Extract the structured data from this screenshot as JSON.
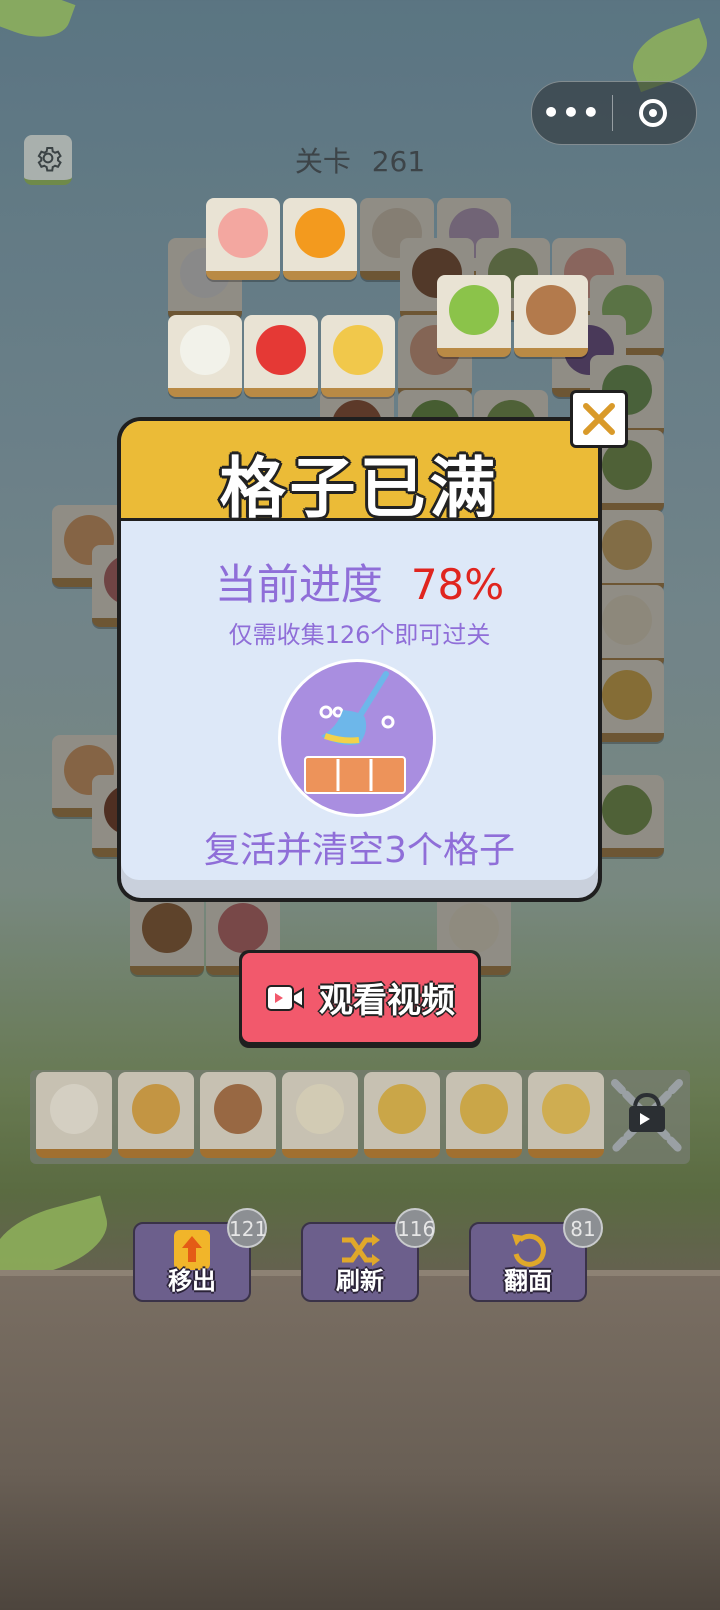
{
  "level": {
    "label": "关卡",
    "number": "261"
  },
  "modal": {
    "title": "格子已满",
    "progress_label": "当前进度",
    "progress_value": "78%",
    "subtitle": "仅需收集126个即可过关",
    "revive_text": "复活并清空3个格子",
    "icon": "broom-icon"
  },
  "watch_button": {
    "label": "观看视频",
    "icon": "video-camera-icon"
  },
  "tray": {
    "tiles": [
      {
        "name": "lotus",
        "color": "#e9e4d8"
      },
      {
        "name": "ginger",
        "color": "#d9a64a"
      },
      {
        "name": "lotus-root",
        "color": "#a9744a"
      },
      {
        "name": "enoki-mushroom",
        "color": "#e9e2c8"
      },
      {
        "name": "pear",
        "color": "#e0b850"
      },
      {
        "name": "pear",
        "color": "#e0b850"
      },
      {
        "name": "melon",
        "color": "#e6c05a"
      }
    ],
    "locked_slot_icon": "chain-video-lock-icon"
  },
  "tools": [
    {
      "label": "移出",
      "count": "121",
      "icon": "move-out-icon"
    },
    {
      "label": "刷新",
      "count": "116",
      "icon": "shuffle-icon"
    },
    {
      "label": "翻面",
      "count": "81",
      "icon": "undo-icon"
    }
  ],
  "capsule": {
    "more_icon": "more-dots-icon",
    "close_icon": "target-circle-icon"
  }
}
